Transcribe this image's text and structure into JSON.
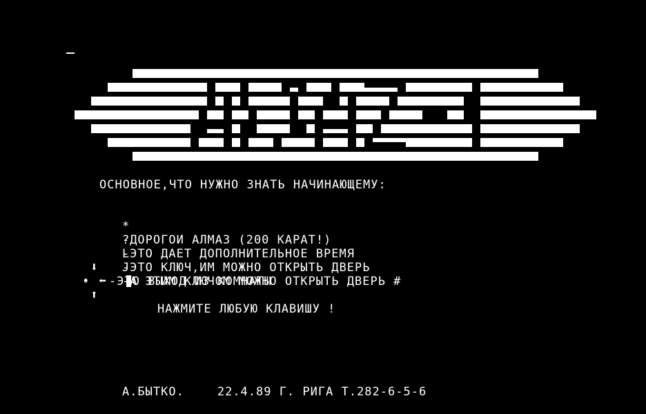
{
  "screen": {
    "background": "#000000",
    "foreground": "#ffffff"
  },
  "heading": "ОСНОВНОЕ,ЧТО НУЖНО ЗНАТЬ НАЧИНАЮЩЕМУ:",
  "legend": [
    {
      "symbol": "*",
      "text": "-ДОРОГОИ АЛМАЗ (200 КАРАТ!)"
    },
    {
      "symbol": "?",
      "text": "-ЭТО ДАЕТ ДОПОЛНИТЕЛЬНОЕ ВРЕМЯ"
    },
    {
      "symbol": "L",
      "text": "-ЭТО КЛЮЧ,ИМ МОЖНО ОТКРЫТЬ ДВЕРЬ"
    },
    {
      "symbol": "J",
      "text": "-А ЭТИМ КЛЮЧОМ МОЖНО ОТКРЫТЬ ДВЕРЬ #"
    }
  ],
  "exit_legend": {
    "text": "-ЭТО ВЫХОД ИЗ КОМНАТЫ",
    "icons": [
      "arrow-down-icon",
      "arrow-right-icon",
      "arrow-left-icon",
      "arrow-up-icon"
    ]
  },
  "prompt": "НАЖМИТЕ ЛЮБУЮ КЛАВИШУ !",
  "footer": {
    "author": "А.БЫТКО.",
    "date_place": "22.4.89 Г. РИГА Т.282-6-5-6"
  }
}
